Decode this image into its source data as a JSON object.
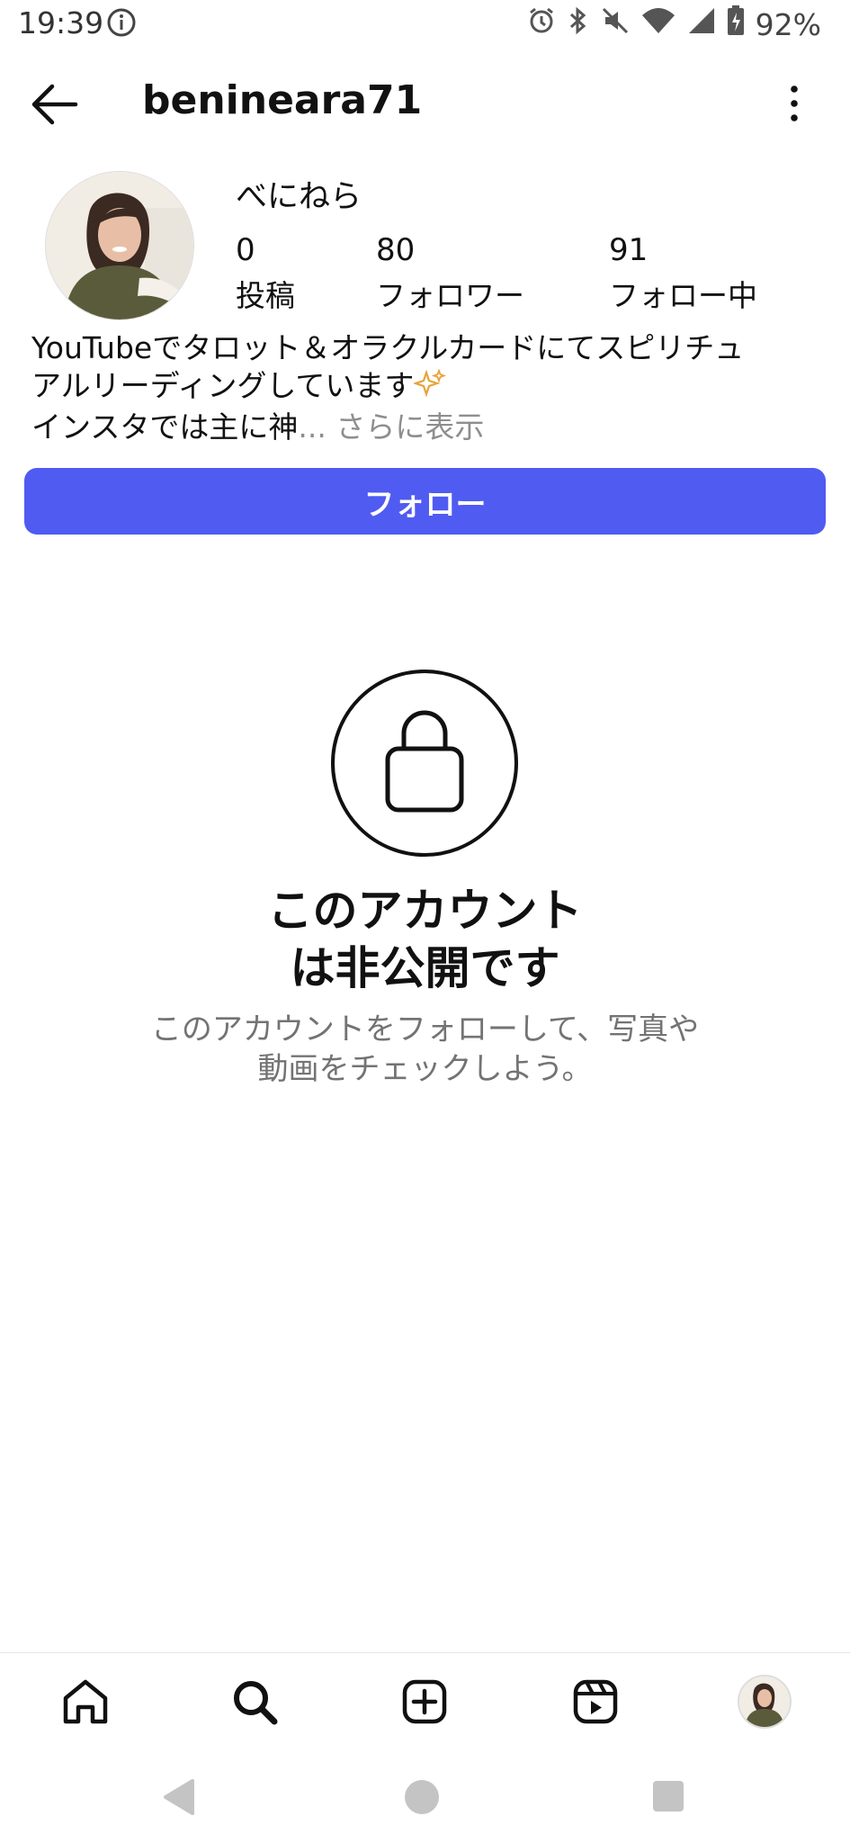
{
  "status_bar": {
    "time": "19:39",
    "battery": "92%",
    "icons": [
      "info-icon",
      "alarm-icon",
      "bluetooth-icon",
      "mute-icon",
      "wifi-icon",
      "signal-icon",
      "battery-icon"
    ]
  },
  "header": {
    "username": "benineara71"
  },
  "profile": {
    "display_name": "べにねら",
    "stats": {
      "posts_count": "0",
      "posts_label": "投稿",
      "followers_count": "80",
      "followers_label": "フォロワー",
      "following_count": "91",
      "following_label": "フォロー中"
    },
    "bio_line1": "YouTubeでタロット＆オラクルカードにてスピリチュ",
    "bio_line2": "アルリーディングしています",
    "bio_line3": "インスタでは主に神",
    "bio_ellipsis": "...",
    "bio_more": "さらに表示"
  },
  "follow_button": {
    "label": "フォロー",
    "color": "#4f5bf1"
  },
  "private": {
    "title_line1": "このアカウント",
    "title_line2": "は非公開です",
    "desc_line1": "このアカウントをフォローして、写真や",
    "desc_line2": "動画をチェックしよう。"
  },
  "bottom_nav": {
    "items": [
      "home-icon",
      "search-icon",
      "create-icon",
      "reels-icon",
      "profile-avatar"
    ]
  }
}
